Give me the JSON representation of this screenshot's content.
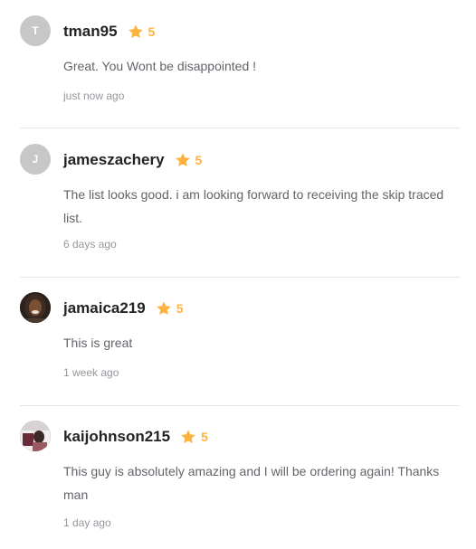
{
  "reviews": [
    {
      "initial": "T",
      "username": "tman95",
      "rating": "5",
      "text": "Great. You Wont be disappointed !",
      "time": "just now ago"
    },
    {
      "initial": "J",
      "username": "jameszachery",
      "rating": "5",
      "text": "The list looks good. i am looking forward to receiving the skip traced list.",
      "time": "6 days ago"
    },
    {
      "username": "jamaica219",
      "rating": "5",
      "text": "This is great",
      "time": "1 week ago"
    },
    {
      "username": "kaijohnson215",
      "rating": "5",
      "text": "This guy is absolutely amazing and I will be ordering again! Thanks man",
      "time": "1 day ago"
    }
  ],
  "colors": {
    "star": "#ffb33e",
    "username": "#222325",
    "body_text": "#62646a",
    "muted_text": "#95979d",
    "avatar_placeholder": "#c7c7c7",
    "divider": "#e4e5e7"
  },
  "icons": {
    "star": "star-icon"
  }
}
